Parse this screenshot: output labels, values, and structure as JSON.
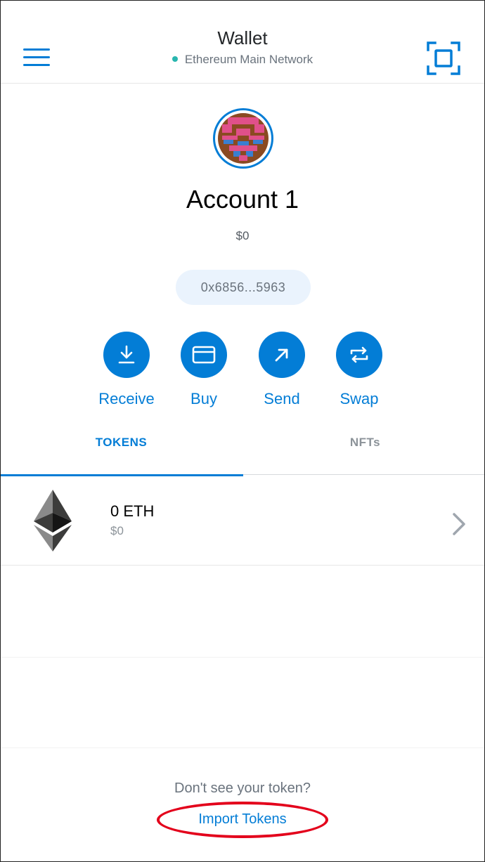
{
  "header": {
    "title": "Wallet",
    "network": "Ethereum Main Network",
    "network_status_color": "#29b6af",
    "menu_icon": "hamburger-menu-icon",
    "scan_icon": "qr-scan-icon"
  },
  "account": {
    "name": "Account 1",
    "balance": "$0",
    "address": "0x6856...5963"
  },
  "actions": [
    {
      "label": "Receive",
      "icon": "download-icon"
    },
    {
      "label": "Buy",
      "icon": "credit-card-icon"
    },
    {
      "label": "Send",
      "icon": "arrow-up-right-icon"
    },
    {
      "label": "Swap",
      "icon": "swap-arrows-icon"
    }
  ],
  "tabs": [
    {
      "label": "TOKENS",
      "active": true
    },
    {
      "label": "NFTs",
      "active": false
    }
  ],
  "tokens": [
    {
      "amount": "0 ETH",
      "fiat": "$0",
      "icon": "ethereum-icon"
    }
  ],
  "footer": {
    "prompt": "Don't see your token?",
    "import_label": "Import Tokens",
    "highlight_color": "#e3001b"
  },
  "colors": {
    "accent": "#037dd6",
    "address_pill": "#eaf3fd"
  }
}
